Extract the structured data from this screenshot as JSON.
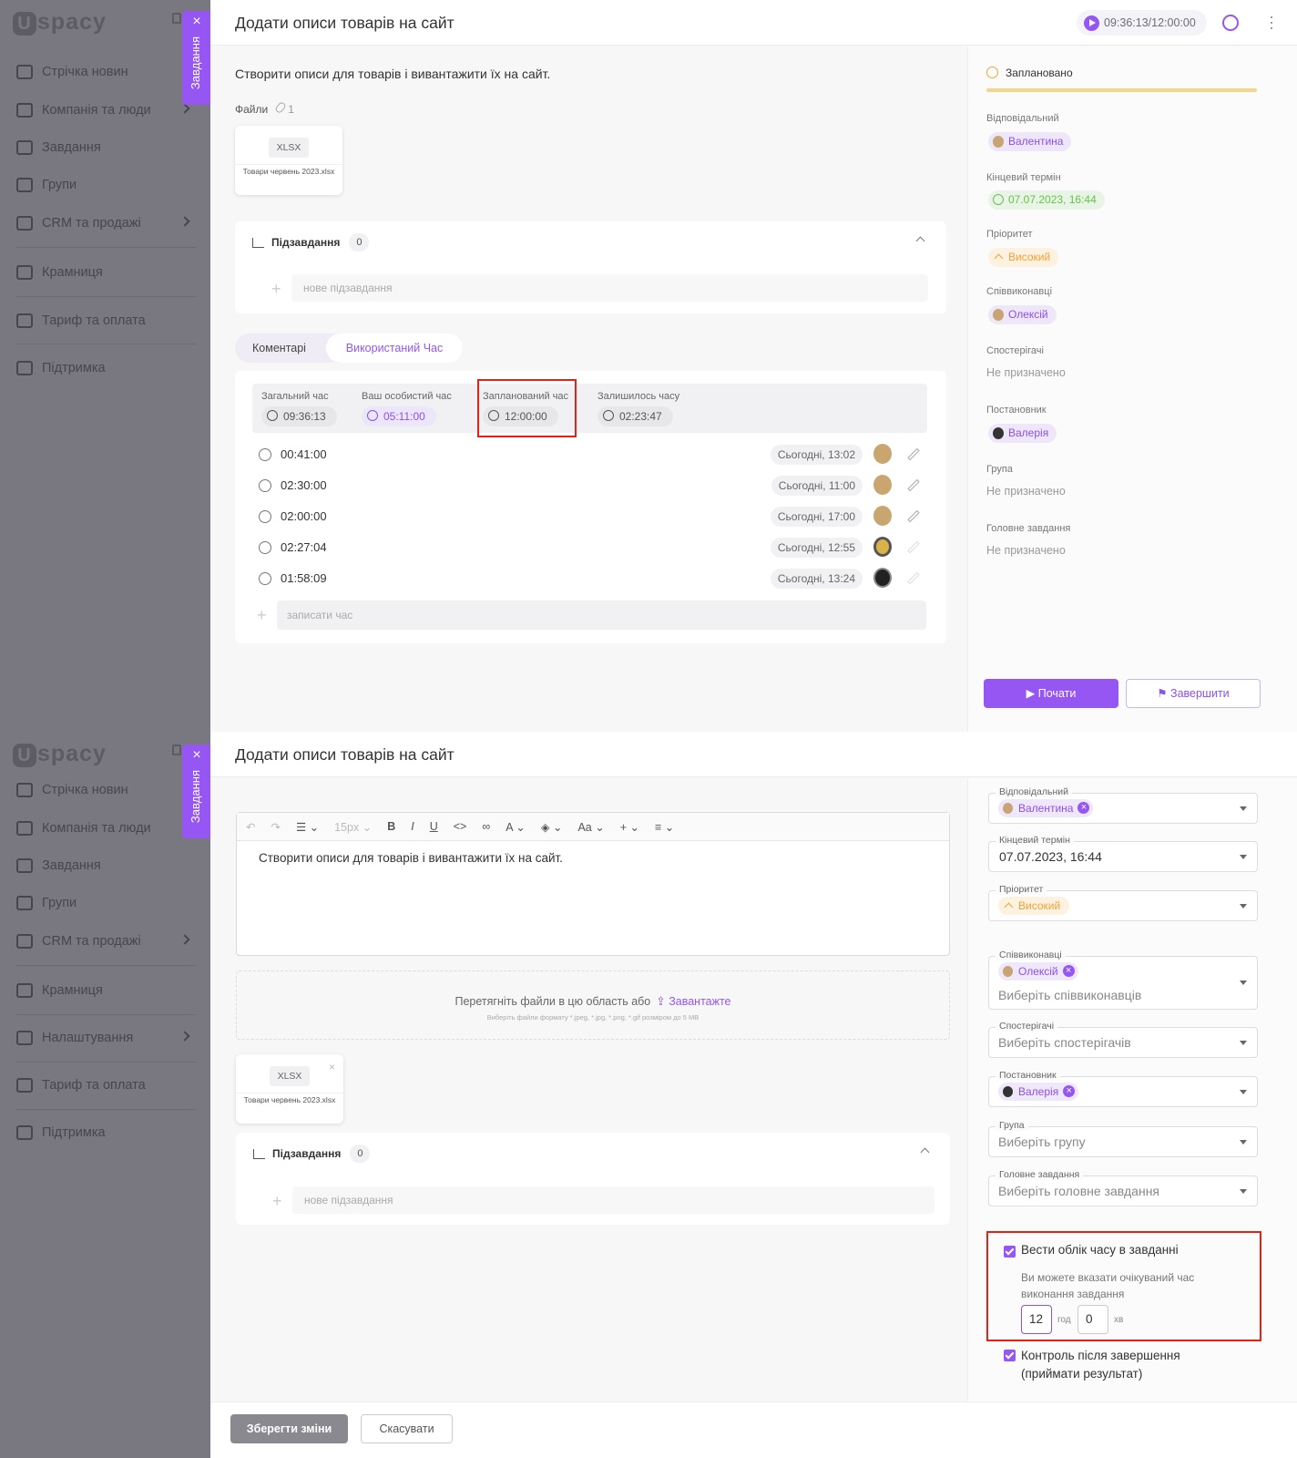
{
  "brand": "spacy",
  "sidebar_tab": {
    "label": "Завдання"
  },
  "sidebar1": {
    "items": [
      "Стрічка новин",
      "Компанія та люди",
      "Завдання",
      "Групи",
      "CRM та продажі",
      "Крамниця",
      "Тариф та оплата",
      "Підтримка"
    ]
  },
  "sidebar2": {
    "items": [
      "Стрічка новин",
      "Компанія та люди",
      "Завдання",
      "Групи",
      "CRM та продажі",
      "Крамниця",
      "Налаштування",
      "Тариф та оплата",
      "Підтримка"
    ]
  },
  "task": {
    "title": "Додати описи товарів на сайт",
    "timer": "09:36:13/12:00:00",
    "description": "Створити описи для товарів і вивантажити їх на сайт."
  },
  "files": {
    "label": "Файли",
    "count": "1",
    "file": {
      "ext": "XLSX",
      "name": "Товари червень 2023.xlsx"
    }
  },
  "subtasks": {
    "label": "Підзавдання",
    "count": "0",
    "placeholder": "нове підзавдання"
  },
  "tabs": {
    "comments": "Коментарі",
    "time": "Використаний Час"
  },
  "stats": [
    {
      "label": "Загальний час",
      "value": "09:36:13"
    },
    {
      "label": "Ваш особистий час",
      "value": "05:11:00"
    },
    {
      "label": "Запланований час",
      "value": "12:00:00"
    },
    {
      "label": "Залишилось часу",
      "value": "02:23:47"
    }
  ],
  "time_entries": [
    {
      "duration": "00:41:00",
      "date": "Сьогодні, 13:02"
    },
    {
      "duration": "02:30:00",
      "date": "Сьогодні, 11:00"
    },
    {
      "duration": "02:00:00",
      "date": "Сьогодні, 17:00"
    },
    {
      "duration": "02:27:04",
      "date": "Сьогодні, 12:55"
    },
    {
      "duration": "01:58:09",
      "date": "Сьогодні, 13:24"
    }
  ],
  "record_time_placeholder": "записати час",
  "details": {
    "status": "Заплановано",
    "responsible_label": "Відповідальний",
    "responsible": "Валентина",
    "deadline_label": "Кінцевий термін",
    "deadline": "07.07.2023, 16:44",
    "priority_label": "Пріоритет",
    "priority": "Високий",
    "coexec_label": "Співвиконавці",
    "coexec": "Олексій",
    "observers_label": "Спостерігачі",
    "observers": "Не призначено",
    "creator_label": "Постановник",
    "creator": "Валерія",
    "group_label": "Група",
    "group": "Не призначено",
    "parent_label": "Головне завдання",
    "parent": "Не призначено"
  },
  "buttons": {
    "start": "Почати",
    "finish": "Завершити",
    "save": "Зберегти зміни",
    "cancel": "Скасувати"
  },
  "editor": {
    "font_size": "15px",
    "case_label": "Aa",
    "text": "Створити описи для товарів і вивантажити їх на сайт."
  },
  "upload": {
    "text": "Перетягніть файли в цю область або",
    "link": "Завантажте",
    "hint": "Виберіть файли формату *.jpeg, *.jpg, *.png, *.gif розміром до 5 MB"
  },
  "edit_fields": {
    "deadline": "07.07.2023, 16:44",
    "coexec_placeholder": "Виберіть співвиконавців",
    "observers_placeholder": "Виберіть спостерігачів",
    "group_placeholder": "Виберіть групу",
    "parent_placeholder": "Виберіть головне завдання"
  },
  "time_tracking": {
    "label": "Вести облік часу в завданні",
    "hint": "Ви можете вказати очікуваний час виконання завдання",
    "hours": "12",
    "hours_unit": "год",
    "minutes": "0",
    "minutes_unit": "хв",
    "control_label": "Контроль після завершення (приймати результат)"
  },
  "colors": {
    "accent": "#9556f4",
    "highlight": "#e2231a",
    "status": "#f3a43a"
  }
}
